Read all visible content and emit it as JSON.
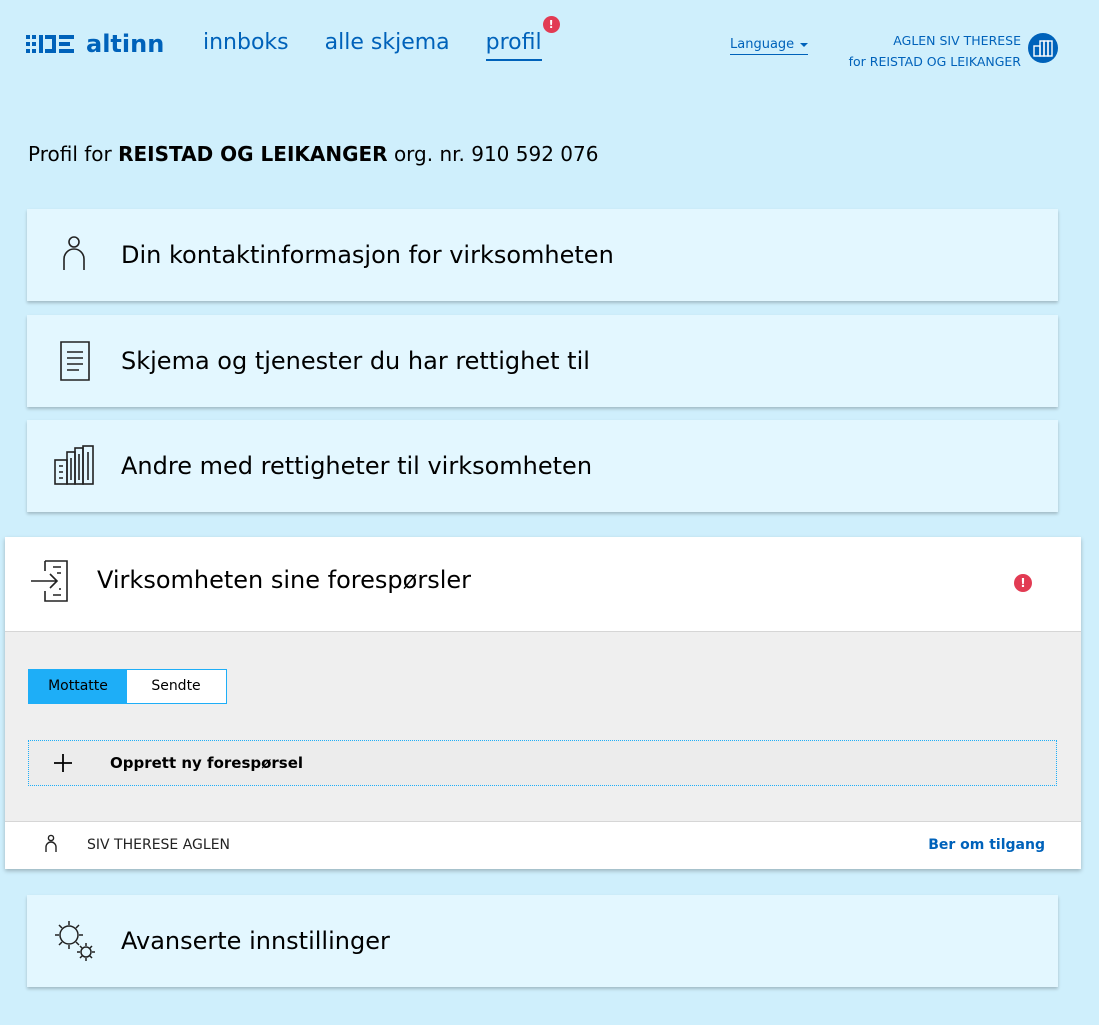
{
  "header": {
    "logo_text": "altinn",
    "nav": [
      {
        "label": "innboks",
        "active": false
      },
      {
        "label": "alle skjema",
        "active": false
      },
      {
        "label": "profil",
        "active": true,
        "badge": "!"
      }
    ],
    "language": "Language",
    "user_name": "AGLEN SIV THERESE",
    "user_org": "for REISTAD OG LEIKANGER"
  },
  "profile": {
    "prefix": "Profil for",
    "org_name": "REISTAD OG LEIKANGER",
    "org_nr": "org. nr. 910 592 076"
  },
  "cards": [
    {
      "label": "Din kontaktinformasjon for virksomheten",
      "icon": "person-icon"
    },
    {
      "label": "Skjema og tjenester du har rettighet til",
      "icon": "document-icon"
    },
    {
      "label": "Andre med rettigheter til virksomheten",
      "icon": "buildings-icon"
    }
  ],
  "requests": {
    "label": "Virksomheten sine forespørsler",
    "badge": "!",
    "tabs": {
      "received": "Mottatte",
      "sent": "Sendte"
    },
    "create_label": "Opprett ny forespørsel",
    "person_name": "SIV THERESE AGLEN",
    "request_link": "Ber om tilgang"
  },
  "advanced": {
    "label": "Avanserte innstillinger",
    "icon": "gears-icon"
  },
  "colors": {
    "background": "#cfeffc",
    "card": "#e3f7ff",
    "accent": "#0062ba",
    "toggle": "#1eaef7",
    "alert": "#e23b53"
  }
}
